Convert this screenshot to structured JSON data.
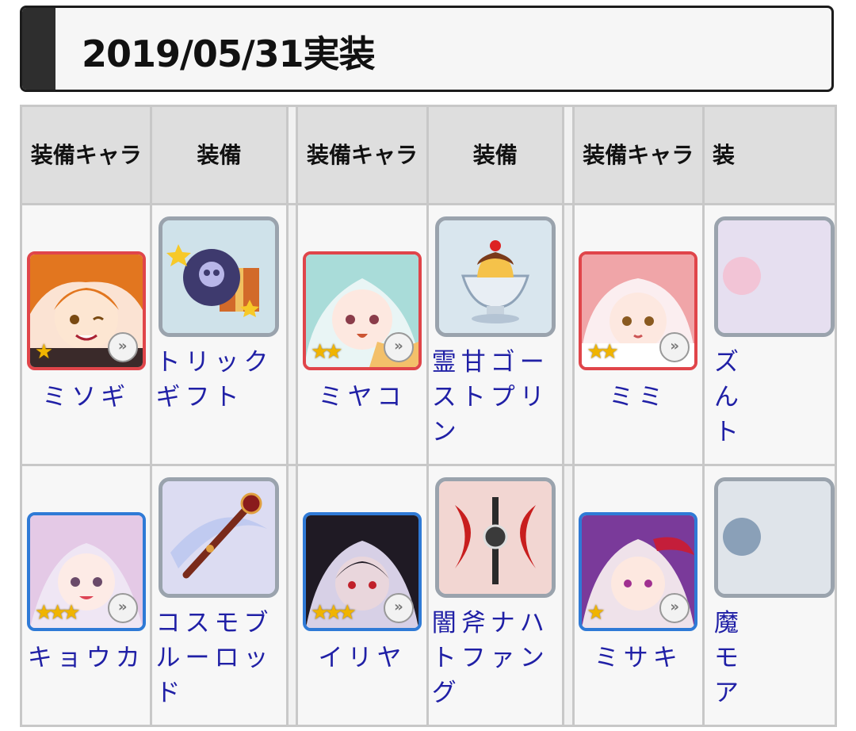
{
  "heading": {
    "title": "2019/05/31実装"
  },
  "table": {
    "headers": [
      "装備キャラ",
      "装備",
      "",
      "装備キャラ",
      "装備",
      "",
      "装備キャラ",
      "装"
    ],
    "rows": [
      [
        {
          "character": "ミソギ",
          "stars": "★",
          "frame": "red",
          "equip": "トリックギフト"
        },
        {
          "character": "ミヤコ",
          "stars": "★★",
          "frame": "red",
          "equip": "霊甘ゴーストプリン"
        },
        {
          "character": "ミミ",
          "stars": "★★",
          "frame": "red",
          "equip": "ズんト"
        }
      ],
      [
        {
          "character": "キョウカ",
          "stars": "★★★",
          "frame": "blue",
          "equip": "コスモブルーロッド"
        },
        {
          "character": "イリヤ",
          "stars": "★★★",
          "frame": "blue",
          "equip": "闇斧ナハトファング"
        },
        {
          "character": "ミサキ",
          "stars": "★",
          "frame": "blue",
          "equip": "魔モア"
        }
      ]
    ]
  },
  "icons": {
    "rank_button": "»",
    "colors": {
      "link": "#2020a6",
      "frame_red": "#e0454a",
      "frame_blue": "#2f7ad6"
    }
  }
}
